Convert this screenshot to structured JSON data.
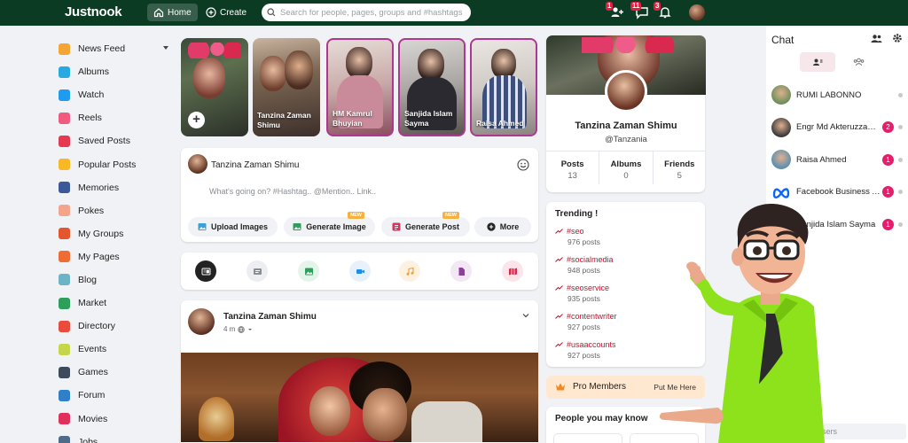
{
  "header": {
    "logo": "Justnook",
    "home_label": "Home",
    "create_label": "Create",
    "search_placeholder": "Search for people, pages, groups and #hashtags",
    "friend_requests_count": "1",
    "messages_count": "11",
    "notifications_count": "3"
  },
  "sidebar": {
    "items": [
      {
        "label": "News Feed",
        "icon": "news-feed-icon",
        "color": "#f4a534"
      },
      {
        "label": "Albums",
        "icon": "albums-icon",
        "color": "#29a9e1"
      },
      {
        "label": "Watch",
        "icon": "watch-icon",
        "color": "#1d9bf0"
      },
      {
        "label": "Reels",
        "icon": "reels-icon",
        "color": "#f05a7e"
      },
      {
        "label": "Saved Posts",
        "icon": "saved-posts-icon",
        "color": "#e53950"
      },
      {
        "label": "Popular Posts",
        "icon": "popular-posts-icon",
        "color": "#f7b924"
      },
      {
        "label": "Memories",
        "icon": "memories-icon",
        "color": "#3b5998"
      },
      {
        "label": "Pokes",
        "icon": "pokes-icon",
        "color": "#f3a48a"
      },
      {
        "label": "My Groups",
        "icon": "my-groups-icon",
        "color": "#e4572e"
      },
      {
        "label": "My Pages",
        "icon": "my-pages-icon",
        "color": "#ef6c34"
      },
      {
        "label": "Blog",
        "icon": "blog-icon",
        "color": "#6bb4c8"
      },
      {
        "label": "Market",
        "icon": "market-icon",
        "color": "#2e9e5b"
      },
      {
        "label": "Directory",
        "icon": "directory-icon",
        "color": "#e94b3c"
      },
      {
        "label": "Events",
        "icon": "events-icon",
        "color": "#c5d64a"
      },
      {
        "label": "Games",
        "icon": "games-icon",
        "color": "#3c4a5c"
      },
      {
        "label": "Forum",
        "icon": "forum-icon",
        "color": "#2f80c9"
      },
      {
        "label": "Movies",
        "icon": "movies-icon",
        "color": "#e0315c"
      },
      {
        "label": "Jobs",
        "icon": "jobs-icon",
        "color": "#4f6b8a"
      }
    ]
  },
  "stories": [
    {
      "name": "",
      "add": true
    },
    {
      "name": "Tanzina Zaman Shimu",
      "ring": false
    },
    {
      "name": "HM Kamrul Bhuyian",
      "ring": true
    },
    {
      "name": "Sanjida Islam Sayma",
      "ring": true
    },
    {
      "name": "Raisa Ahmed",
      "ring": true
    }
  ],
  "composer": {
    "user_name": "Tanzina Zaman Shimu",
    "placeholder": "What's going on? #Hashtag.. @Mention.. Link..",
    "upload_label": "Upload Images",
    "generate_image_label": "Generate Image",
    "generate_post_label": "Generate Post",
    "more_label": "More",
    "new_tag": "NEW"
  },
  "post": {
    "author": "Tanzina Zaman Shimu",
    "time": "4 m"
  },
  "profile": {
    "name": "Tanzina Zaman Shimu",
    "handle": "@Tanzania",
    "stats": [
      {
        "label": "Posts",
        "value": "13"
      },
      {
        "label": "Albums",
        "value": "0"
      },
      {
        "label": "Friends",
        "value": "5"
      }
    ]
  },
  "trending": {
    "title": "Trending !",
    "items": [
      {
        "tag": "#seo",
        "count": "976 posts"
      },
      {
        "tag": "#socialmedia",
        "count": "948 posts"
      },
      {
        "tag": "#seoservice",
        "count": "935 posts"
      },
      {
        "tag": "#contentwriter",
        "count": "927 posts"
      },
      {
        "tag": "#usaaccounts",
        "count": "927 posts"
      }
    ]
  },
  "pro_members": {
    "label": "Pro Members",
    "link": "Put Me Here"
  },
  "people_you_may_know": {
    "title": "People you may know"
  },
  "chat": {
    "title": "Chat",
    "contacts": [
      {
        "name": "RUMI LABONNO",
        "unread": ""
      },
      {
        "name": "Engr Md Akteruzzaman",
        "unread": "2"
      },
      {
        "name": "Raisa Ahmed",
        "unread": "1"
      },
      {
        "name": "Facebook Business Account",
        "unread": "1"
      },
      {
        "name": "Sanjida Islam Sayma",
        "unread": "1"
      }
    ],
    "search_placeholder": "Search for users"
  }
}
